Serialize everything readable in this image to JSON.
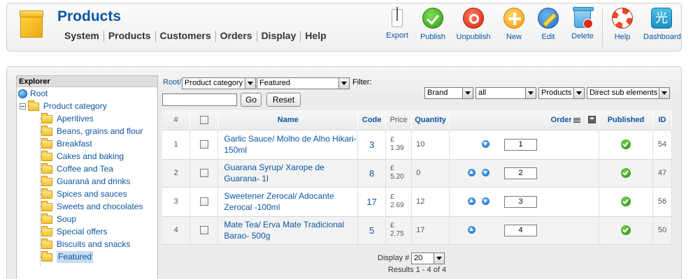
{
  "header": {
    "title": "Products",
    "menu": [
      "System",
      "Products",
      "Customers",
      "Orders",
      "Display",
      "Help"
    ],
    "toolbar": [
      {
        "label": "Export",
        "icon": "export-icon"
      },
      {
        "label": "Publish",
        "icon": "publish-icon"
      },
      {
        "label": "Unpublish",
        "icon": "unpublish-icon"
      },
      {
        "label": "New",
        "icon": "new-icon"
      },
      {
        "label": "Edit",
        "icon": "edit-icon"
      },
      {
        "label": "Delete",
        "icon": "delete-icon"
      },
      {
        "label": "Help",
        "icon": "help-icon"
      },
      {
        "label": "Dashboard",
        "icon": "dashboard-icon"
      }
    ]
  },
  "explorer": {
    "title": "Explorer",
    "root": "Root",
    "category": "Product category",
    "items": [
      "Aperitives",
      "Beans, grains and flour",
      "Breakfast",
      "Cakes and baking",
      "Coffee and Tea",
      "Guaraná and drinks",
      "Spices and sauces",
      "Sweets and chocolates",
      "Soup",
      "Special offers",
      "Biscuits and snacks",
      "Featured"
    ],
    "selected": "Featured"
  },
  "filters": {
    "breadcrumb": "Root/",
    "category_select": "Product category",
    "subcategory_select": "Featured",
    "filter_label": "Filter:",
    "search_value": "",
    "go_label": "Go",
    "reset_label": "Reset",
    "brand_select": "Brand",
    "brand_value_select": "all",
    "type_select": "Products",
    "scope_select": "Direct sub elements"
  },
  "table": {
    "columns": {
      "num": "#",
      "name": "Name",
      "code": "Code",
      "price": "Price",
      "quantity": "Quantity",
      "order": "Order",
      "published": "Published",
      "id": "ID"
    },
    "rows": [
      {
        "num": "1",
        "name": "Garlic Sauce/ Molho de Alho Hikari- 150ml",
        "code": "3",
        "price_currency": "£",
        "price_value": "1.39",
        "quantity": "10",
        "order": "1",
        "id": "54",
        "up": false,
        "down": true
      },
      {
        "num": "2",
        "name": "Guarana Syrup/ Xarope de Guarana- 1l",
        "code": "8",
        "price_currency": "£",
        "price_value": "5.20",
        "quantity": "0",
        "order": "2",
        "id": "47",
        "up": true,
        "down": true
      },
      {
        "num": "3",
        "name": "Sweetener Zerocal/ Adocante Zerocal -100ml",
        "code": "17",
        "price_currency": "£",
        "price_value": "2.69",
        "quantity": "12",
        "order": "3",
        "id": "56",
        "up": true,
        "down": true
      },
      {
        "num": "4",
        "name": "Mate Tea/ Erva Mate Tradicional Barao- 500g",
        "code": "5",
        "price_currency": "£",
        "price_value": "2.75",
        "quantity": "17",
        "order": "4",
        "id": "50",
        "up": true,
        "down": false
      }
    ]
  },
  "pagination": {
    "display_label": "Display #",
    "display_value": "20",
    "results_text": "Results 1 - 4 of 4"
  },
  "colors": {
    "link": "#0b55a4",
    "publish_green": "#2f9c15",
    "unpublish_red": "#d5240e"
  }
}
